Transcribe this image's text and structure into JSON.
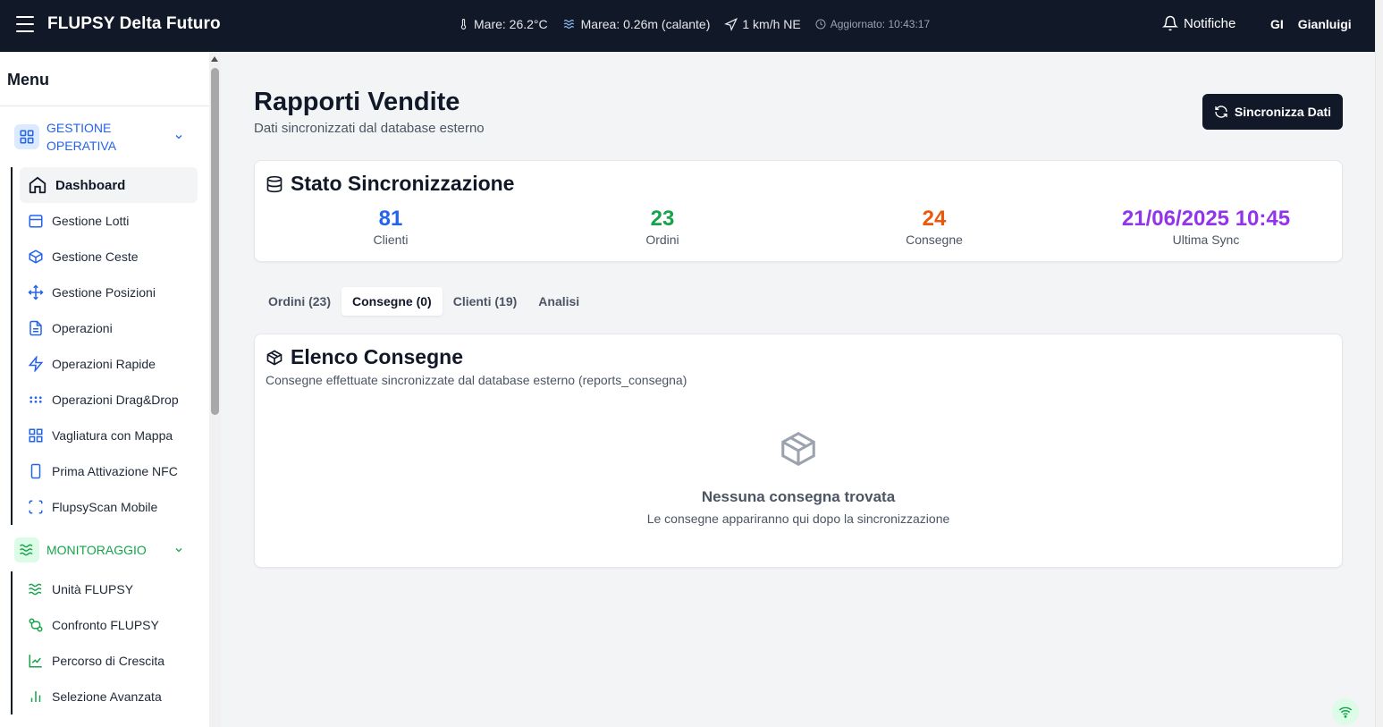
{
  "header": {
    "title": "FLUPSY Delta Futuro",
    "weather": {
      "sea": "Mare: 26.2°C",
      "tide": "Marea: 0.26m (calante)",
      "wind": "1 km/h NE",
      "updated": "Aggiornato: 10:43:17"
    },
    "notifications_label": "Notifiche",
    "user_initials": "GI",
    "user_name": "Gianluigi"
  },
  "sidebar": {
    "title": "Menu",
    "groups": [
      {
        "label": "GESTIONE OPERATIVA",
        "color": "#2563eb",
        "items": [
          {
            "label": "Dashboard",
            "icon": "home-icon",
            "active": true
          },
          {
            "label": "Gestione Lotti",
            "icon": "calendar-icon"
          },
          {
            "label": "Gestione Ceste",
            "icon": "box-icon"
          },
          {
            "label": "Gestione Posizioni",
            "icon": "move-icon"
          },
          {
            "label": "Operazioni",
            "icon": "file-text-icon"
          },
          {
            "label": "Operazioni Rapide",
            "icon": "zap-icon"
          },
          {
            "label": "Operazioni Drag&Drop",
            "icon": "grip-icon"
          },
          {
            "label": "Vagliatura con Mappa",
            "icon": "grid-icon"
          },
          {
            "label": "Prima Attivazione NFC",
            "icon": "smartphone-icon"
          },
          {
            "label": "FlupsyScan Mobile",
            "icon": "scan-icon"
          }
        ]
      },
      {
        "label": "MONITORAGGIO",
        "color": "#16a34a",
        "items": [
          {
            "label": "Unità FLUPSY",
            "icon": "waves-icon"
          },
          {
            "label": "Confronto FLUPSY",
            "icon": "git-compare-icon"
          },
          {
            "label": "Percorso di Crescita",
            "icon": "line-chart-icon"
          },
          {
            "label": "Selezione Avanzata",
            "icon": "bar-chart-icon"
          }
        ]
      }
    ]
  },
  "main": {
    "title": "Rapporti Vendite",
    "subtitle": "Dati sincronizzati dal database esterno",
    "sync_button": "Sincronizza Dati",
    "sync_card": {
      "title": "Stato Sincronizzazione",
      "stats": [
        {
          "value": "81",
          "label": "Clienti",
          "color": "#2563eb"
        },
        {
          "value": "23",
          "label": "Ordini",
          "color": "#16a34a"
        },
        {
          "value": "24",
          "label": "Consegne",
          "color": "#ea580c"
        },
        {
          "value": "21/06/2025 10:45",
          "label": "Ultima Sync",
          "color": "#9333ea"
        }
      ]
    },
    "tabs": [
      {
        "label": "Ordini (23)",
        "active": false
      },
      {
        "label": "Consegne (0)",
        "active": true
      },
      {
        "label": "Clienti (19)",
        "active": false
      },
      {
        "label": "Analisi",
        "active": false
      }
    ],
    "deliveries_card": {
      "title": "Elenco Consegne",
      "subtitle": "Consegne effettuate sincronizzate dal database esterno (reports_consegna)",
      "empty_title": "Nessuna consegna trovata",
      "empty_subtitle": "Le consegne appariranno qui dopo la sincronizzazione"
    }
  }
}
